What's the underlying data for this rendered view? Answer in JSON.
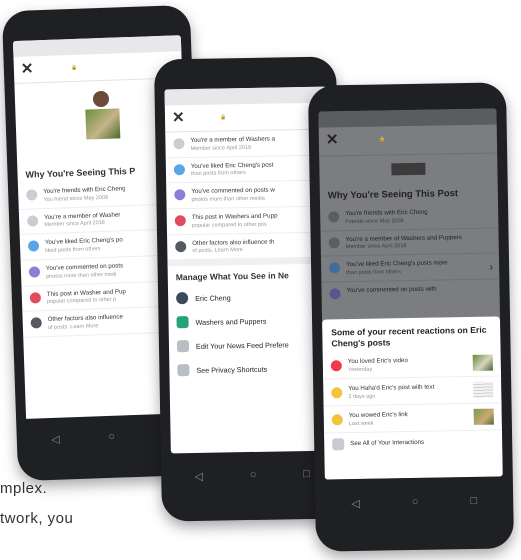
{
  "captions": [
    "mplex.",
    "twork, you"
  ],
  "phone1": {
    "section_title": "Why You're Seeing This P",
    "rows": [
      {
        "text": "You're friends with Eric Cheng",
        "sub": "You friend since May 2009"
      },
      {
        "text": "You're a member of Washer",
        "sub": "Member since April 2018"
      },
      {
        "text": "You've liked Eric Cheng's po",
        "sub": "liked posts from others"
      },
      {
        "text": "You've commented on posts",
        "sub": "photos more than other medi"
      },
      {
        "text": "This post in Washer and Pup",
        "sub": "popular compared to other p"
      },
      {
        "text": "Other factors also influence",
        "sub": "of posts. Learn More"
      }
    ],
    "nav": [
      "◁",
      "○",
      "□"
    ]
  },
  "phone2": {
    "rows": [
      {
        "text": "You're a member of Washers a",
        "sub": "Member since April 2019"
      },
      {
        "text": "You've liked Eric Cheng's post",
        "sub": "than posts from others"
      },
      {
        "text": "You've commented on posts w",
        "sub": "photos more than other media"
      },
      {
        "text": "This post in Washers and Pupp",
        "sub": "popular compared to other pos"
      },
      {
        "text": "Other factors also influence th",
        "sub": "of posts. Learn More"
      }
    ],
    "manage_title": "Manage What You See in Ne",
    "manage": [
      {
        "label": "Eric Cheng"
      },
      {
        "label": "Washers and Puppers"
      },
      {
        "label": "Edit Your News Feed Prefere"
      },
      {
        "label": "See Privacy Shortcuts"
      }
    ],
    "nav": [
      "◁",
      "○",
      "□"
    ]
  },
  "phone3": {
    "section_title": "Why You're Seeing This Post",
    "rows": [
      {
        "text": "You're friends with Eric Cheng",
        "sub": "Friends since May 2009"
      },
      {
        "text": "You're a member of Washers and Puppers",
        "sub": "Member since April 2018"
      },
      {
        "text": "You've liked Eric Cheng's posts more",
        "sub": "than posts from others"
      },
      {
        "text": "You've commented on posts with",
        "sub": ""
      }
    ],
    "sheet_title": "Some of your recent reactions on Eric Cheng's posts",
    "reactions": [
      {
        "text": "You loved Eric's video",
        "sub": "Yesterday"
      },
      {
        "text": "You Haha'd Eric's post with text",
        "sub": "2 days ago"
      },
      {
        "text": "You wowed Eric's link",
        "sub": "Last week"
      }
    ],
    "see_all": "See All of Your Interactions",
    "nav": [
      "◁",
      "○",
      "□"
    ]
  }
}
